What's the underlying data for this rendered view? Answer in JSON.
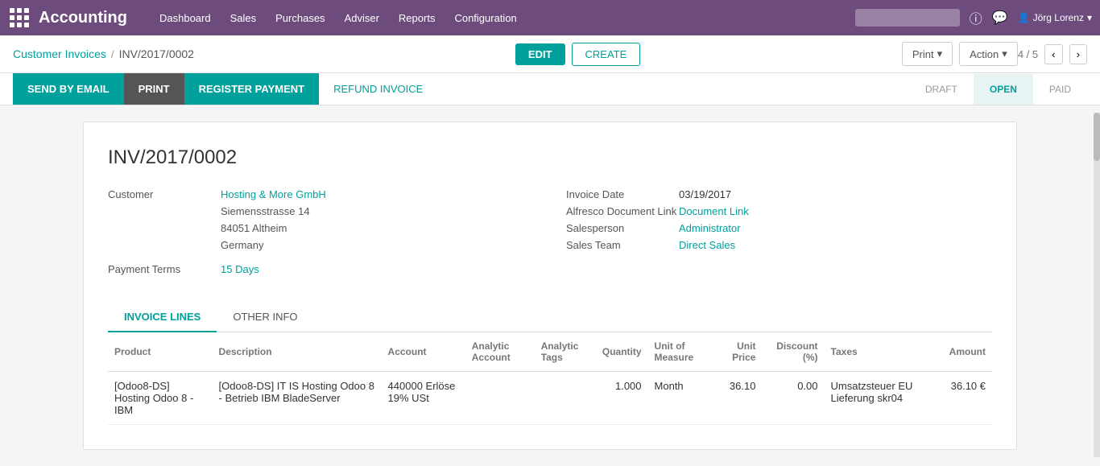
{
  "topnav": {
    "brand": "Accounting",
    "nav_items": [
      "Dashboard",
      "Sales",
      "Purchases",
      "Adviser",
      "Reports",
      "Configuration"
    ],
    "search_placeholder": "",
    "user": "Jörg Lorenz"
  },
  "breadcrumb": {
    "parent": "Customer Invoices",
    "separator": "/",
    "current": "INV/2017/0002"
  },
  "toolbar": {
    "edit_label": "EDIT",
    "create_label": "CREATE",
    "print_label": "Print",
    "action_label": "Action",
    "pagination": "4 / 5"
  },
  "workflow": {
    "send_by_email": "SEND BY EMAIL",
    "print": "PRINT",
    "register_payment": "REGISTER PAYMENT",
    "refund_invoice": "REFUND INVOICE",
    "steps": [
      "DRAFT",
      "OPEN",
      "PAID"
    ]
  },
  "invoice": {
    "number": "INV/2017/0002",
    "customer_label": "Customer",
    "customer_name": "Hosting & More GmbH",
    "customer_address": [
      "Siemensstrasse 14",
      "84051 Altheim",
      "Germany"
    ],
    "payment_terms_label": "Payment Terms",
    "payment_terms_value": "15 Days",
    "invoice_date_label": "Invoice Date",
    "invoice_date_value": "03/19/2017",
    "alfresco_label": "Alfresco Document Link",
    "alfresco_value": "Document Link",
    "salesperson_label": "Salesperson",
    "salesperson_value": "Administrator",
    "sales_team_label": "Sales Team",
    "sales_team_value": "Direct Sales"
  },
  "tabs": {
    "items": [
      "INVOICE LINES",
      "OTHER INFO"
    ],
    "active": 0
  },
  "table": {
    "columns": [
      "Product",
      "Description",
      "Account",
      "Analytic Account",
      "Analytic Tags",
      "Quantity",
      "Unit of Measure",
      "Unit Price",
      "Discount (%)",
      "Taxes",
      "Amount"
    ],
    "rows": [
      {
        "product": "[Odoo8-DS] Hosting Odoo 8 - IBM",
        "description": "[Odoo8-DS] IT IS Hosting Odoo 8 - Betrieb IBM BladeServer",
        "account": "440000 Erlöse 19% USt",
        "analytic_account": "",
        "analytic_tags": "",
        "quantity": "1.000",
        "unit_of_measure": "Month",
        "unit_price": "36.10",
        "discount": "0.00",
        "taxes": "Umsatzsteuer EU Lieferung skr04",
        "amount": "36.10 €"
      }
    ]
  }
}
